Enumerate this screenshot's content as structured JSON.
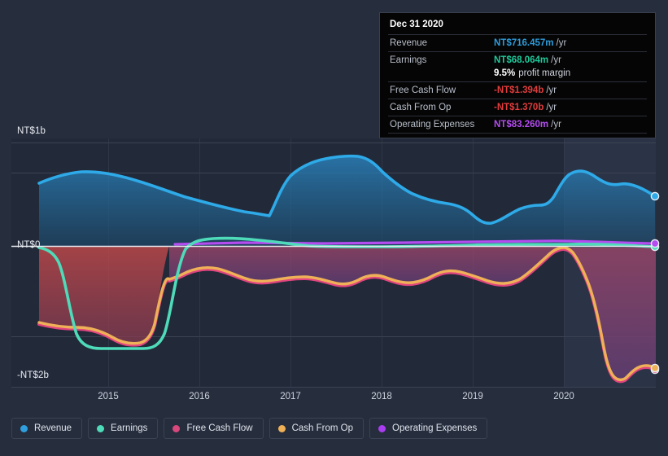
{
  "chart_data": {
    "type": "area",
    "title": "",
    "xlabel": "",
    "ylabel": "",
    "currency_prefix": "NT$",
    "grid": true,
    "legend_position": "bottom",
    "y_axis": {
      "labels": [
        "NT$1b",
        "NT$0",
        "-NT$2b"
      ],
      "values": [
        1000000000,
        0,
        -2000000000
      ],
      "ylim": [
        -2200000000,
        1200000000
      ]
    },
    "x_axis": {
      "tick_labels": [
        "2015",
        "2016",
        "2017",
        "2018",
        "2019",
        "2020"
      ],
      "xlim": [
        "2014-07",
        "2021-03"
      ]
    },
    "highlight_region": {
      "from": "2020",
      "label": ""
    },
    "series": [
      {
        "name": "Revenue",
        "color": "#2eaae8",
        "fill": "#1d4f73",
        "x": [
          "2014-09",
          "2015-01",
          "2015-04",
          "2015-07",
          "2015-10",
          "2016-01",
          "2016-04",
          "2016-07",
          "2016-10",
          "2017-01",
          "2017-04",
          "2017-07",
          "2017-10",
          "2018-01",
          "2018-04",
          "2018-07",
          "2018-10",
          "2019-01",
          "2019-04",
          "2019-07",
          "2019-10",
          "2020-01",
          "2020-04",
          "2020-07",
          "2020-10",
          "2020-12"
        ],
        "values": [
          575,
          640,
          660,
          640,
          600,
          560,
          540,
          520,
          505,
          760,
          830,
          880,
          900,
          860,
          800,
          760,
          730,
          700,
          690,
          620,
          645,
          650,
          800,
          760,
          740,
          716.457
        ]
      },
      {
        "name": "Earnings",
        "color": "#4edbb9",
        "x": [
          "2014-09",
          "2015-01",
          "2015-04",
          "2015-07",
          "2015-10",
          "2016-01",
          "2016-04",
          "2016-07",
          "2016-10",
          "2017-01",
          "2017-04",
          "2017-07",
          "2017-10",
          "2018-01",
          "2018-04",
          "2018-07",
          "2018-10",
          "2019-01",
          "2019-04",
          "2019-07",
          "2019-10",
          "2020-01",
          "2020-04",
          "2020-07",
          "2020-10",
          "2020-12"
        ],
        "values": [
          -30,
          -1660,
          -1790,
          -1800,
          -1790,
          30,
          45,
          60,
          70,
          55,
          35,
          20,
          15,
          20,
          25,
          30,
          30,
          30,
          35,
          35,
          40,
          45,
          55,
          60,
          62,
          68.064
        ]
      },
      {
        "name": "Free Cash Flow",
        "color": "#e05a8c",
        "x": [
          "2014-09",
          "2015-01",
          "2015-04",
          "2015-07",
          "2015-10",
          "2016-01",
          "2016-04",
          "2016-07",
          "2016-10",
          "2017-01",
          "2017-04",
          "2017-07",
          "2017-10",
          "2018-01",
          "2018-04",
          "2018-07",
          "2018-10",
          "2019-01",
          "2019-04",
          "2019-07",
          "2019-10",
          "2020-01",
          "2020-04",
          "2020-07",
          "2020-10",
          "2020-12"
        ],
        "values": [
          -1410,
          -1595,
          -1620,
          -1625,
          -1630,
          -345,
          -300,
          -330,
          -470,
          -400,
          -170,
          30,
          60,
          -50,
          -230,
          -280,
          -275,
          -215,
          -290,
          -280,
          -290,
          30,
          -170,
          -1560,
          -1620,
          -1394
        ]
      },
      {
        "name": "Cash From Op",
        "color": "#efb056",
        "x": [
          "2014-09",
          "2015-01",
          "2015-04",
          "2015-07",
          "2015-10",
          "2016-01",
          "2016-04",
          "2016-07",
          "2016-10",
          "2017-01",
          "2017-04",
          "2017-07",
          "2017-10",
          "2018-01",
          "2018-04",
          "2018-07",
          "2018-10",
          "2019-01",
          "2019-04",
          "2019-07",
          "2019-10",
          "2020-01",
          "2020-04",
          "2020-07",
          "2020-10",
          "2020-12"
        ],
        "values": [
          -1390,
          -1580,
          -1605,
          -1610,
          -1615,
          -330,
          -290,
          -320,
          -460,
          -390,
          -160,
          40,
          70,
          -40,
          -220,
          -270,
          -265,
          -205,
          -280,
          -270,
          -280,
          40,
          -160,
          -1550,
          -1610,
          -1370
        ]
      },
      {
        "name": "Operating Expenses",
        "color": "#b44cf0",
        "x": [
          "2014-09",
          "2015-01",
          "2015-04",
          "2015-07",
          "2015-10",
          "2016-01",
          "2016-04",
          "2016-07",
          "2016-10",
          "2017-01",
          "2017-04",
          "2017-07",
          "2017-10",
          "2018-01",
          "2018-04",
          "2018-07",
          "2018-10",
          "2019-01",
          "2019-04",
          "2019-07",
          "2019-10",
          "2020-01",
          "2020-04",
          "2020-07",
          "2020-10",
          "2020-12"
        ],
        "values": [
          0,
          0,
          0,
          0,
          0,
          55,
          58,
          60,
          62,
          62,
          60,
          58,
          58,
          60,
          62,
          64,
          66,
          68,
          70,
          72,
          74,
          78,
          82,
          84,
          84,
          83.26
        ]
      }
    ]
  },
  "tooltip": {
    "date": "Dec 31 2020",
    "rows": [
      {
        "label": "Revenue",
        "value": "NT$716.457m",
        "unit": "/yr",
        "color": "#2d9cdb",
        "sub": ""
      },
      {
        "label": "Earnings",
        "value": "NT$68.064m",
        "unit": "/yr",
        "color": "#1fc99a",
        "sub": ""
      },
      {
        "label": "",
        "value": "9.5%",
        "unit": "",
        "color": "#ffffff",
        "sub": "profit margin"
      },
      {
        "label": "Free Cash Flow",
        "value": "-NT$1.394b",
        "unit": "/yr",
        "color": "#e03c3c",
        "sub": ""
      },
      {
        "label": "Cash From Op",
        "value": "-NT$1.370b",
        "unit": "/yr",
        "color": "#e03c3c",
        "sub": ""
      },
      {
        "label": "Operating Expenses",
        "value": "NT$83.260m",
        "unit": "/yr",
        "color": "#b44cf0",
        "sub": ""
      }
    ]
  },
  "legend": {
    "items": [
      {
        "label": "Revenue",
        "color": "#2f9fe0"
      },
      {
        "label": "Earnings",
        "color": "#4edbb9"
      },
      {
        "label": "Free Cash Flow",
        "color": "#d8487d"
      },
      {
        "label": "Cash From Op",
        "color": "#efb056"
      },
      {
        "label": "Operating Expenses",
        "color": "#a93ef0"
      }
    ]
  },
  "axis_labels": {
    "y_top": "NT$1b",
    "y_zero": "NT$0",
    "y_bottom": "-NT$2b",
    "x": [
      "2015",
      "2016",
      "2017",
      "2018",
      "2019",
      "2020"
    ]
  }
}
